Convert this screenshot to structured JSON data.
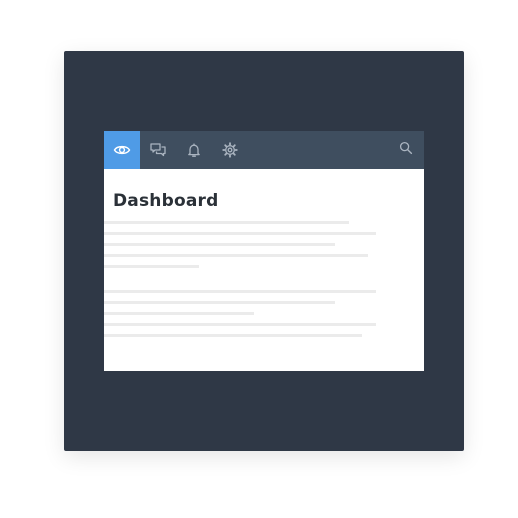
{
  "page": {
    "title": "Dashboard"
  },
  "navbar": {
    "items": [
      {
        "icon": "eye-icon",
        "active": true
      },
      {
        "icon": "chat-icon",
        "active": false
      },
      {
        "icon": "bell-icon",
        "active": false
      },
      {
        "icon": "gear-icon",
        "active": false
      }
    ],
    "search_icon": "search-icon"
  },
  "colors": {
    "frame_background": "#2f3846",
    "navbar_background": "#3f4e5f",
    "active_tab": "#4f9be6",
    "icon_inactive": "#aab4c0",
    "placeholder_line": "#ebebeb",
    "title_text": "#2b3138"
  }
}
